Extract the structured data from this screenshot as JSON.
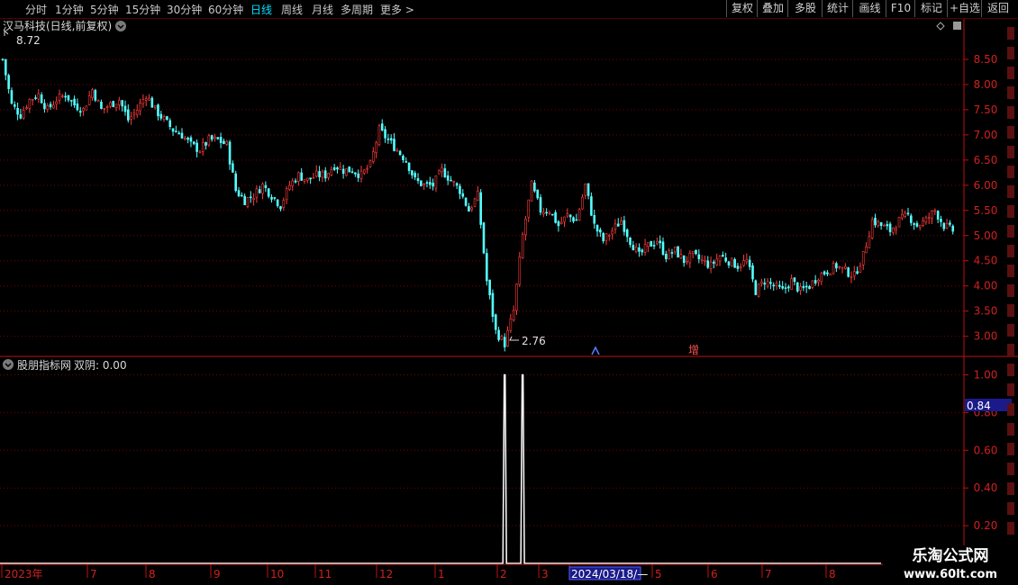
{
  "toolbar": {
    "periods": [
      "分时",
      "1分钟",
      "5分钟",
      "15分钟",
      "30分钟",
      "60分钟",
      "日线",
      "周线",
      "月线",
      "多周期",
      "更多 >"
    ],
    "active_index": 6,
    "actions": [
      "复权",
      "叠加",
      "多股",
      "统计",
      "画线",
      "F10",
      "标记",
      "+自选",
      "返回"
    ]
  },
  "main_panel": {
    "title": "汉马科技(日线,前复权)",
    "high_label": "8.72",
    "low_label": "2.76",
    "marker_text": "增"
  },
  "indicator_panel": {
    "title": "股朋指标网",
    "value_label": "双阴: 0.00",
    "cursor_value": "0.84"
  },
  "watermark": {
    "line1": "乐淘公式网",
    "line2": "www.60lt.com"
  },
  "colors": {
    "up": "#ff3c3c",
    "down": "#54ffff",
    "axis": "#c01010",
    "grid": "#7a0000",
    "signal": "#ffffff"
  },
  "chart_data": {
    "type": "candlestick",
    "price_axis": {
      "ticks": [
        "8.50",
        "8.00",
        "7.50",
        "7.00",
        "6.50",
        "6.00",
        "5.50",
        "5.00",
        "4.50",
        "4.00",
        "3.50",
        "3.00"
      ],
      "range": [
        2.6,
        9.0
      ]
    },
    "indicator_axis": {
      "ticks": [
        "1.00",
        "0.80",
        "0.60",
        "0.40",
        "0.20"
      ],
      "range": [
        0,
        1.05
      ]
    },
    "x_axis_labels": [
      "2023年",
      "7",
      "8",
      "9",
      "10",
      "11",
      "12",
      "1",
      "2",
      "3",
      "2024/03/18/—",
      "5",
      "6",
      "7",
      "8"
    ],
    "close_path": [
      [
        0,
        8.5
      ],
      [
        3,
        7.6
      ],
      [
        6,
        7.4
      ],
      [
        9,
        7.7
      ],
      [
        12,
        7.8
      ],
      [
        15,
        7.5
      ],
      [
        18,
        7.7
      ],
      [
        21,
        7.8
      ],
      [
        24,
        7.6
      ],
      [
        27,
        7.5
      ],
      [
        30,
        7.9
      ],
      [
        33,
        7.5
      ],
      [
        36,
        7.6
      ],
      [
        39,
        7.7
      ],
      [
        42,
        7.3
      ],
      [
        45,
        7.5
      ],
      [
        48,
        7.8
      ],
      [
        51,
        7.5
      ],
      [
        54,
        7.3
      ],
      [
        57,
        7.1
      ],
      [
        60,
        7.0
      ],
      [
        63,
        6.8
      ],
      [
        66,
        6.7
      ],
      [
        69,
        6.9
      ],
      [
        72,
        6.9
      ],
      [
        75,
        6.8
      ],
      [
        78,
        5.9
      ],
      [
        81,
        5.7
      ],
      [
        84,
        5.8
      ],
      [
        87,
        6.0
      ],
      [
        90,
        5.8
      ],
      [
        93,
        5.6
      ],
      [
        96,
        6.0
      ],
      [
        99,
        6.2
      ],
      [
        102,
        6.1
      ],
      [
        105,
        6.2
      ],
      [
        108,
        6.2
      ],
      [
        111,
        6.4
      ],
      [
        114,
        6.3
      ],
      [
        117,
        6.3
      ],
      [
        120,
        6.2
      ],
      [
        123,
        6.4
      ],
      [
        126,
        7.1
      ],
      [
        129,
        6.9
      ],
      [
        132,
        6.7
      ],
      [
        135,
        6.5
      ],
      [
        138,
        6.1
      ],
      [
        141,
        6.0
      ],
      [
        144,
        6.0
      ],
      [
        147,
        6.3
      ],
      [
        150,
        6.1
      ],
      [
        153,
        5.9
      ],
      [
        156,
        5.5
      ],
      [
        159,
        5.8
      ],
      [
        162,
        4.1
      ],
      [
        165,
        3.1
      ],
      [
        168,
        2.85
      ],
      [
        171,
        3.5
      ],
      [
        174,
        5.0
      ],
      [
        177,
        6.0
      ],
      [
        180,
        5.5
      ],
      [
        183,
        5.5
      ],
      [
        186,
        5.2
      ],
      [
        189,
        5.4
      ],
      [
        192,
        5.3
      ],
      [
        195,
        6.0
      ],
      [
        198,
        5.2
      ],
      [
        201,
        4.9
      ],
      [
        204,
        5.1
      ],
      [
        207,
        5.3
      ],
      [
        210,
        4.9
      ],
      [
        213,
        4.6
      ],
      [
        216,
        4.8
      ],
      [
        219,
        4.9
      ],
      [
        222,
        4.6
      ],
      [
        225,
        4.7
      ],
      [
        228,
        4.5
      ],
      [
        231,
        4.6
      ],
      [
        234,
        4.5
      ],
      [
        237,
        4.4
      ],
      [
        240,
        4.6
      ],
      [
        243,
        4.5
      ],
      [
        246,
        4.4
      ],
      [
        249,
        4.5
      ],
      [
        252,
        3.9
      ],
      [
        255,
        4.1
      ],
      [
        258,
        4.0
      ],
      [
        261,
        3.9
      ],
      [
        264,
        4.1
      ],
      [
        267,
        3.9
      ],
      [
        270,
        4.0
      ],
      [
        273,
        4.2
      ],
      [
        276,
        4.3
      ],
      [
        279,
        4.4
      ],
      [
        282,
        4.3
      ],
      [
        285,
        4.2
      ],
      [
        288,
        4.6
      ],
      [
        291,
        5.3
      ],
      [
        294,
        5.2
      ],
      [
        297,
        5.1
      ],
      [
        300,
        5.3
      ],
      [
        303,
        5.4
      ],
      [
        306,
        5.2
      ],
      [
        309,
        5.3
      ],
      [
        312,
        5.5
      ],
      [
        315,
        5.2
      ],
      [
        318,
        5.1
      ]
    ],
    "signal_bars": [
      168,
      174
    ],
    "signal_value": 1.0
  }
}
